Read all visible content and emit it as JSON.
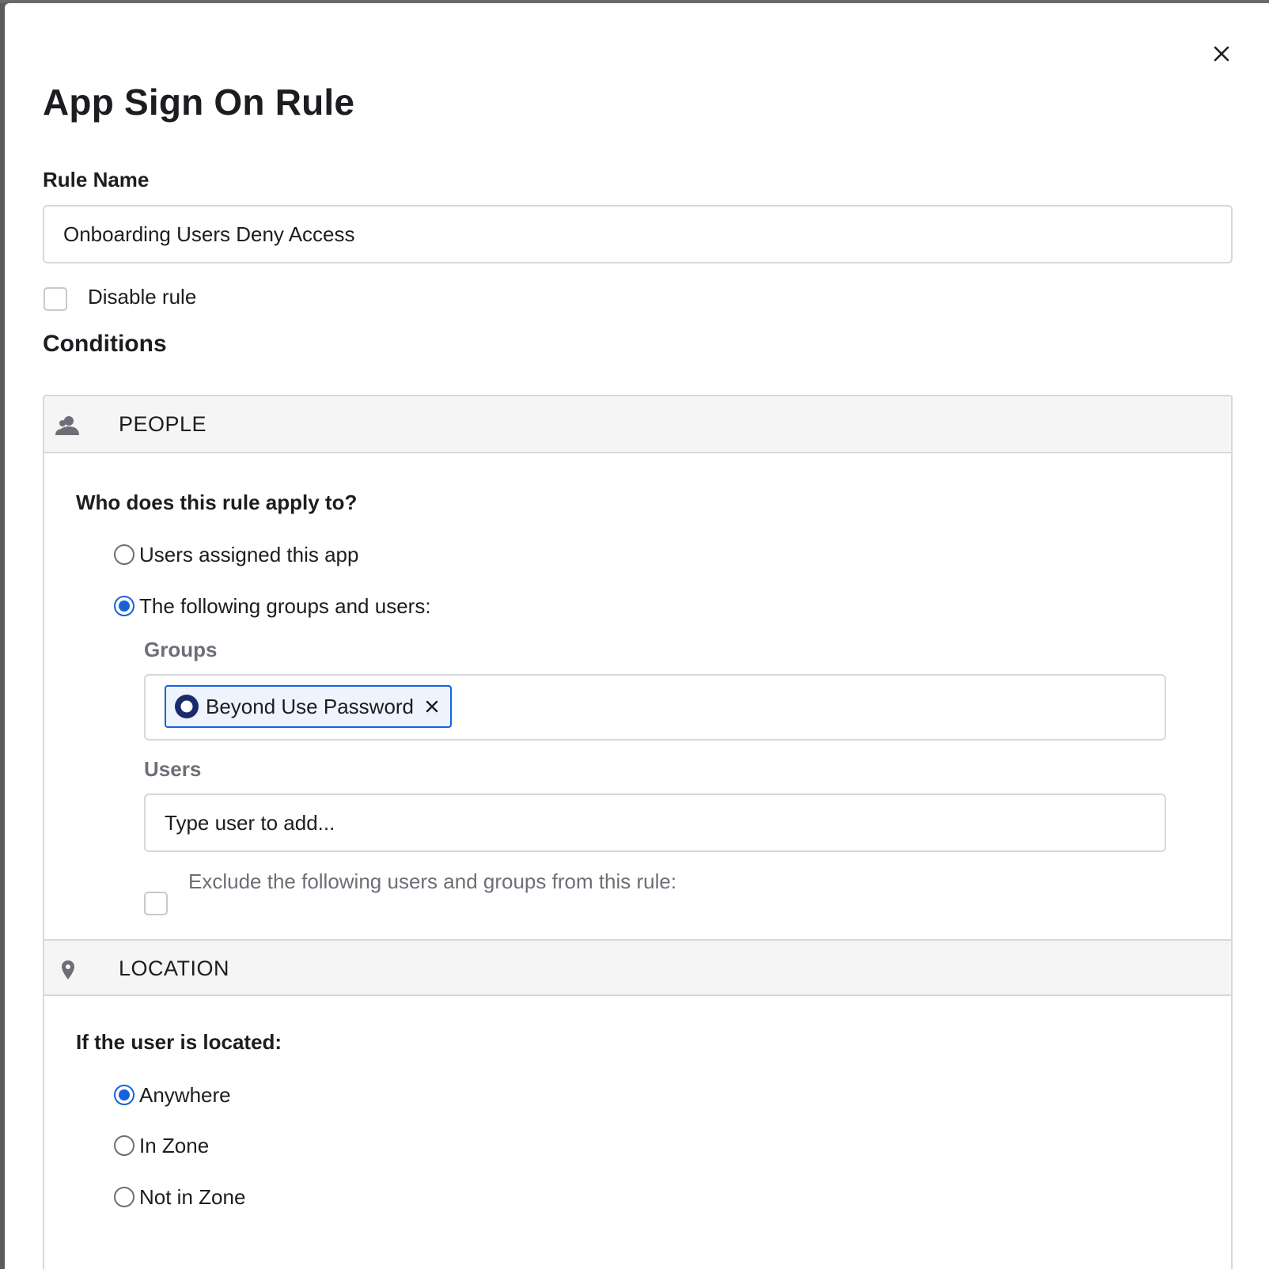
{
  "dialog": {
    "title": "App Sign On Rule",
    "close_icon": "close-icon"
  },
  "rule_name": {
    "label": "Rule Name",
    "value": "Onboarding Users Deny Access"
  },
  "disable_rule": {
    "label": "Disable rule",
    "checked": false
  },
  "conditions": {
    "title": "Conditions",
    "people": {
      "header": "PEOPLE",
      "icon": "people-icon",
      "question": "Who does this rule apply to?",
      "options": [
        {
          "label": "Users assigned this app",
          "selected": false
        },
        {
          "label": "The following groups and users:",
          "selected": true
        }
      ],
      "groups": {
        "label": "Groups",
        "chips": [
          {
            "label": "Beyond Use Password",
            "icon": "group-icon"
          }
        ]
      },
      "users": {
        "label": "Users",
        "placeholder": "Type user to add..."
      },
      "exclude": {
        "label": "Exclude the following users and groups from this rule:",
        "checked": false
      }
    },
    "location": {
      "header": "LOCATION",
      "icon": "location-pin-icon",
      "question": "If the user is located:",
      "options": [
        {
          "label": "Anywhere",
          "selected": true
        },
        {
          "label": "In Zone",
          "selected": false
        },
        {
          "label": "Not in Zone",
          "selected": false
        }
      ]
    }
  },
  "colors": {
    "accent": "#1662dd",
    "chip_background": "#eef3fd",
    "header_background": "#f5f5f6",
    "border": "#d7d7dc"
  }
}
